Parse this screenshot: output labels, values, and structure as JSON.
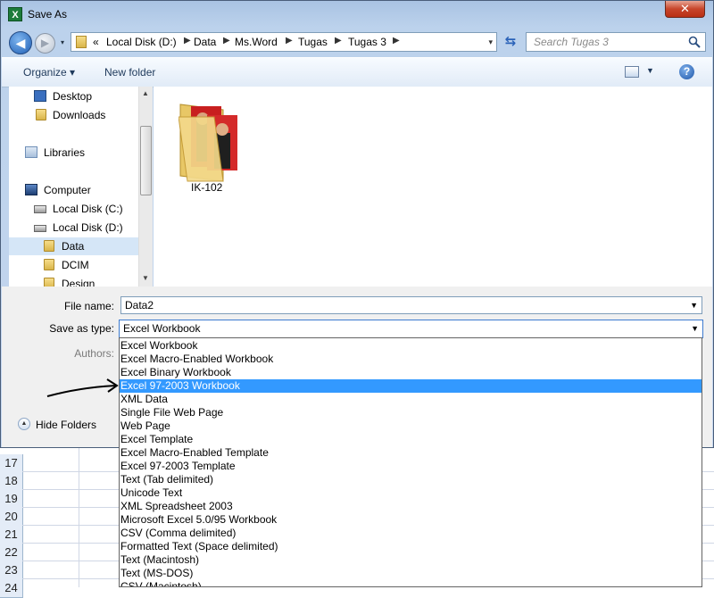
{
  "window": {
    "title": "Save As",
    "close_label": "✕",
    "app_icon_letter": "X"
  },
  "nav": {
    "back_label": "◀",
    "forward_label": "▶",
    "history_drop": "▾"
  },
  "address": {
    "overflow": "«",
    "crumbs": [
      "Local Disk (D:)",
      "Data",
      "Ms.Word",
      "Tugas",
      "Tugas 3"
    ],
    "dropdown": "▾"
  },
  "search": {
    "placeholder": "Search Tugas 3"
  },
  "toolbar": {
    "organize": "Organize ▾",
    "new_folder": "New folder",
    "help": "?"
  },
  "navpane": {
    "items": [
      {
        "label": "Desktop",
        "icon": "desktop-icon"
      },
      {
        "label": "Downloads",
        "icon": "folder-icon"
      },
      {
        "label": "Libraries",
        "icon": "libraries-icon"
      },
      {
        "label": "Computer",
        "icon": "computer-icon"
      },
      {
        "label": "Local Disk (C:)",
        "icon": "drive-icon"
      },
      {
        "label": "Local Disk (D:)",
        "icon": "drive-icon"
      },
      {
        "label": "Data",
        "icon": "folder-icon",
        "selected": true
      },
      {
        "label": "DCIM",
        "icon": "folder-icon"
      },
      {
        "label": "Design",
        "icon": "folder-icon"
      }
    ]
  },
  "files": [
    {
      "name": "IK-102",
      "icon": "photo-folder-icon"
    }
  ],
  "form": {
    "file_name_label": "File name:",
    "file_name_value": "Data2",
    "save_as_type_label": "Save as type:",
    "save_as_type_value": "Excel Workbook",
    "authors_label": "Authors:",
    "hide_folders": "Hide Folders"
  },
  "save_type_options": [
    "Excel Workbook",
    "Excel Macro-Enabled Workbook",
    "Excel Binary Workbook",
    "Excel 97-2003 Workbook",
    "XML Data",
    "Single File Web Page",
    "Web Page",
    "Excel Template",
    "Excel Macro-Enabled Template",
    "Excel 97-2003 Template",
    "Text (Tab delimited)",
    "Unicode Text",
    "XML Spreadsheet 2003",
    "Microsoft Excel 5.0/95 Workbook",
    "CSV (Comma delimited)",
    "Formatted Text (Space delimited)",
    "Text (Macintosh)",
    "Text (MS-DOS)",
    "CSV (Macintosh)"
  ],
  "highlighted_option": "Excel 97-2003 Workbook",
  "sheet_rows": [
    "17",
    "18",
    "19",
    "20",
    "21",
    "22",
    "23",
    "24"
  ],
  "colors": {
    "highlight": "#3399ff",
    "selection": "#d5e6f7",
    "close": "#c7452b"
  }
}
